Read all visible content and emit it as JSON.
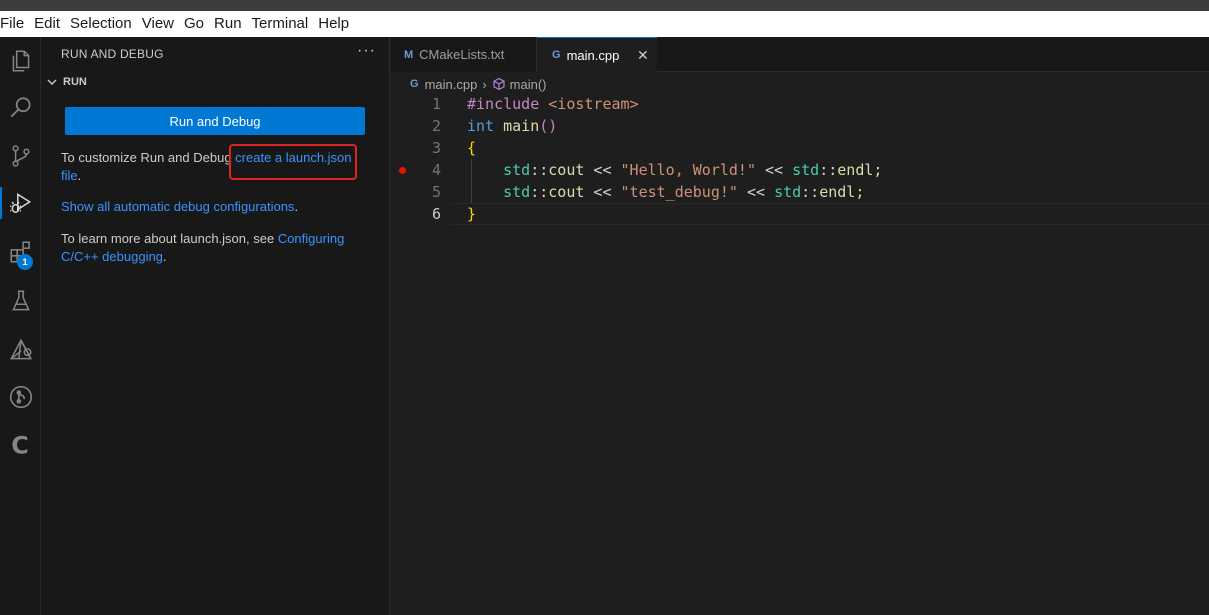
{
  "menu": [
    "File",
    "Edit",
    "Selection",
    "View",
    "Go",
    "Run",
    "Terminal",
    "Help"
  ],
  "activity_bar": {
    "icons": [
      "explorer-icon",
      "search-icon",
      "source-control-icon",
      "run-debug-icon",
      "extensions-icon",
      "testing-icon",
      "cmake-icon",
      "git-graph-icon",
      "c-icon"
    ],
    "extensions_badge": "1",
    "accent_color": "#0078d4"
  },
  "sidebar": {
    "title": "RUN AND DEBUG",
    "more": "···",
    "section": "RUN",
    "run_button": "Run and Debug",
    "p1_pre": "To customize Run and Debug ",
    "p1_link1": "create a launch.json",
    "p1_link2": "file",
    "p1_post": ".",
    "p2_link": "Show all automatic debug configurations",
    "p2_post": ".",
    "p3_pre": "To learn more about launch.json, see ",
    "p3_link1": "Configuring",
    "p3_link2": "C/C++ debugging",
    "p3_post": "."
  },
  "tabs": [
    {
      "icon": "M",
      "label": "CMakeLists.txt",
      "active": false
    },
    {
      "icon": "G",
      "label": "main.cpp",
      "active": true,
      "close": "✕"
    }
  ],
  "breadcrumb": {
    "file": "main.cpp",
    "symbol": "main()",
    "file_icon": "G",
    "sep": "›"
  },
  "editor": {
    "line_numbers": [
      "1",
      "2",
      "3",
      "4",
      "5",
      "6"
    ],
    "breakpoint_line": "4",
    "lines": {
      "l1_a": "#include ",
      "l1_b": "<iostream>",
      "l2_a": "int",
      "l2_b": " ",
      "l2_c": "main",
      "l2_d": "()",
      "l3": "{",
      "l4_a": "    ",
      "l4_ns1": "std",
      "l4_op1": "::",
      "l4_cout": "cout",
      "l4_op2": " << ",
      "l4_str": "\"Hello, World!\"",
      "l4_op3": " << ",
      "l4_ns2": "std",
      "l4_op4": "::",
      "l4_endl": "endl;",
      "l5_a": "    ",
      "l5_ns1": "std",
      "l5_op1": "::",
      "l5_cout": "cout",
      "l5_op2": " << ",
      "l5_str": "\"test_debug!\"",
      "l5_op3": " << ",
      "l5_ns2": "std",
      "l5_op4": "::",
      "l5_endl": "endl;",
      "l6": "}"
    }
  }
}
